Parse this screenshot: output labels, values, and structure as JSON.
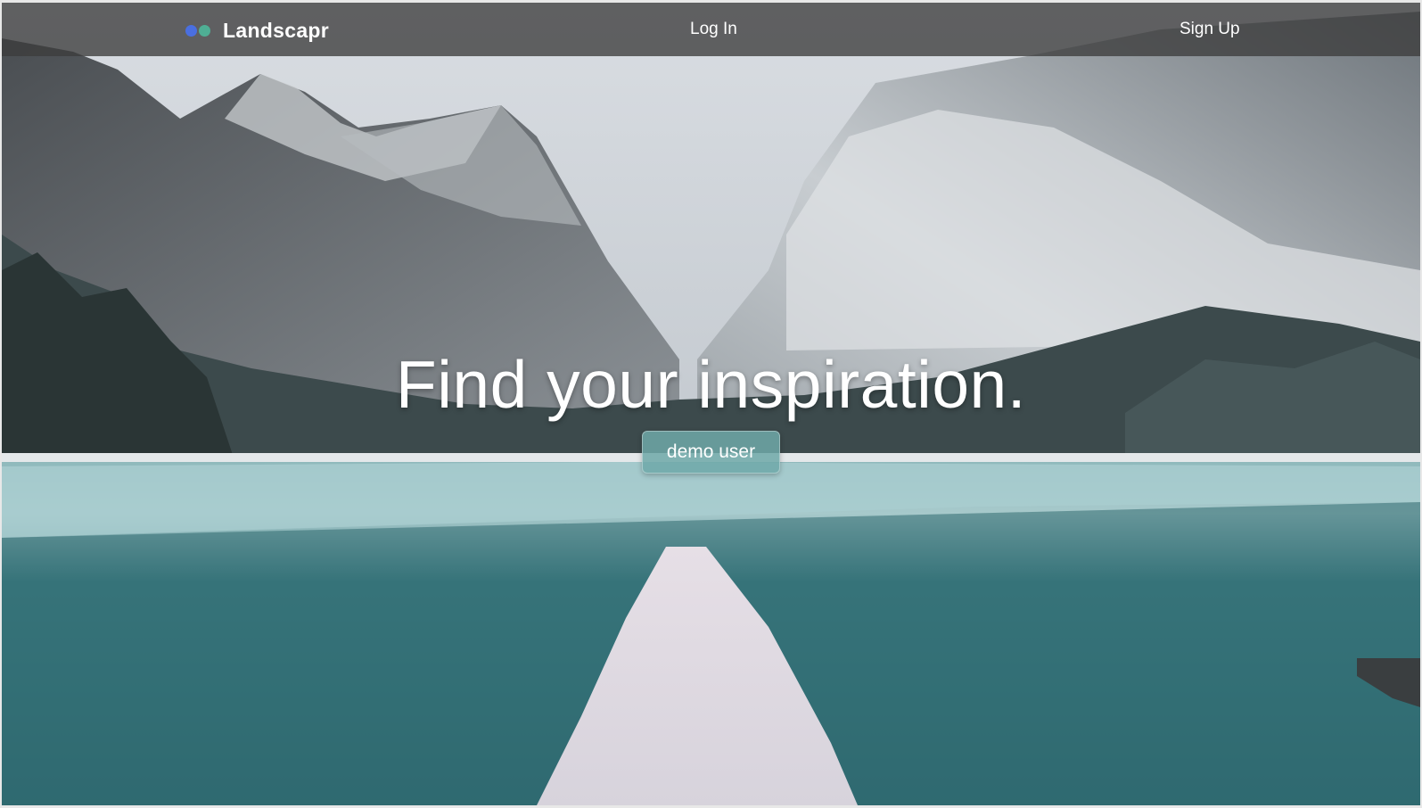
{
  "navbar": {
    "brand": "Landscapr",
    "login_label": "Log In",
    "signup_label": "Sign Up",
    "logo_colors": [
      "#4a6fe0",
      "#4fae94"
    ]
  },
  "hero": {
    "headline": "Find your inspiration.",
    "demo_button_label": "demo user",
    "image": "snowy-mountain-lake-landscape"
  },
  "colors": {
    "navbar_bg": "#3c3c3c",
    "button_bg": "#6ea8a8",
    "text": "#ffffff"
  }
}
